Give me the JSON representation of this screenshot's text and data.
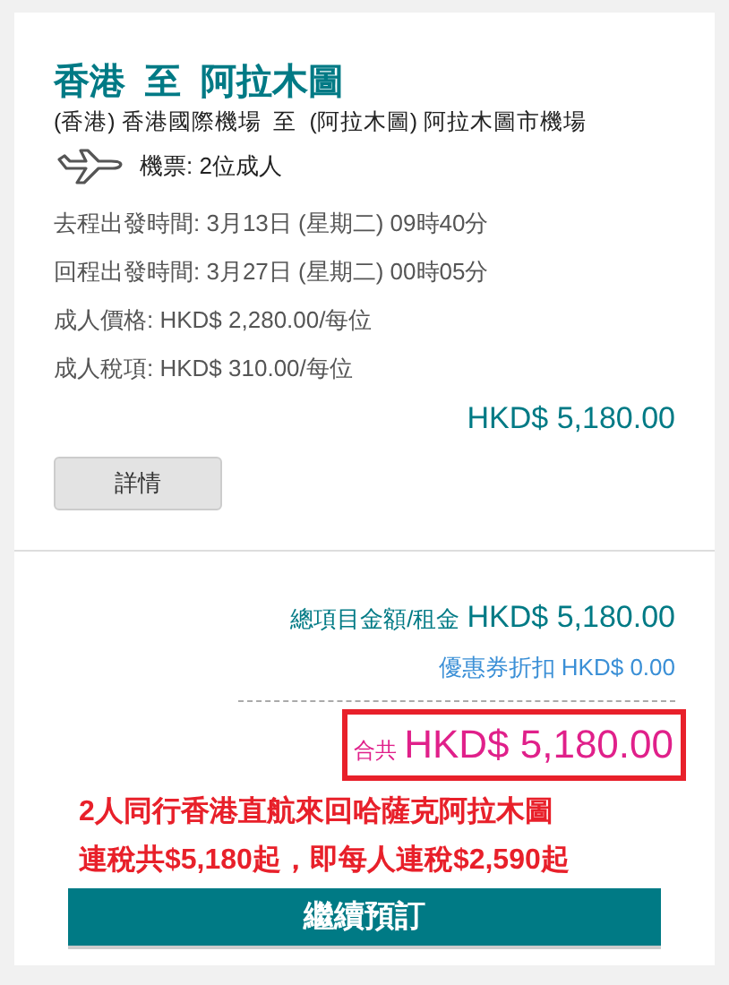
{
  "route": {
    "title": "香港  至  阿拉木圖",
    "airports": "(香港) 香港國際機場  至  (阿拉木圖) 阿拉木圖市機場",
    "tickets": "機票: 2位成人"
  },
  "details": [
    "去程出發時間: 3月13日 (星期二) 09時40分",
    "回程出發時間: 3月27日 (星期二) 00時05分",
    "成人價格: HKD$ 2,280.00/每位",
    "成人稅項: HKD$ 310.00/每位"
  ],
  "subtotal": "HKD$ 5,180.00",
  "details_button": "詳情",
  "summary": {
    "items_label": "總項目金額/租金",
    "items_amount": "HKD$ 5,180.00",
    "coupon": "優惠券折扣 HKD$ 0.00",
    "total_label": "合共",
    "total_amount": "HKD$ 5,180.00"
  },
  "promo": [
    "2人同行香港直航來回哈薩克阿拉木圖",
    "連稅共$5,180起，即每人連稅$2,590起"
  ],
  "continue_button": "繼續預訂"
}
